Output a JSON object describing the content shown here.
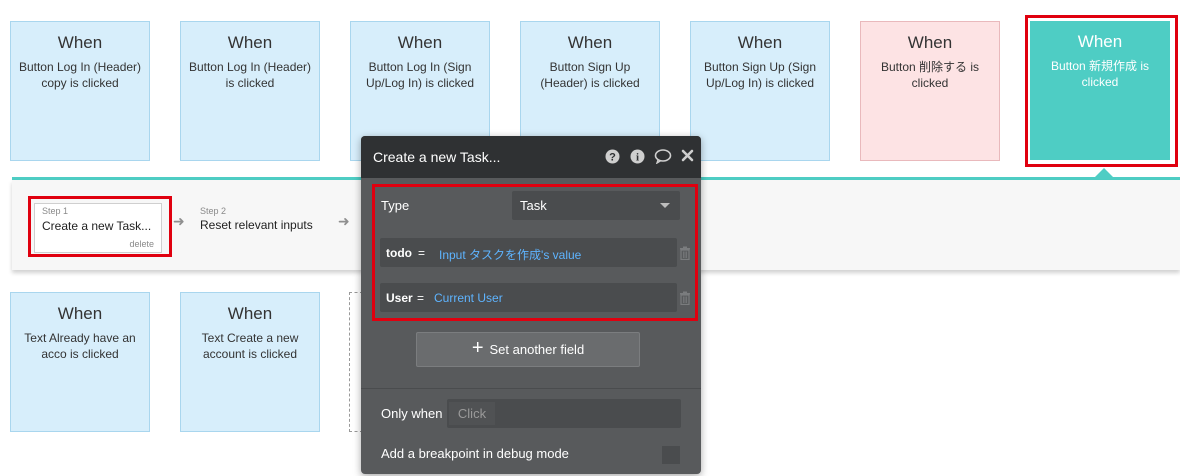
{
  "events": [
    {
      "when": "When",
      "desc": "Button Log In (Header) copy is clicked"
    },
    {
      "when": "When",
      "desc": "Button Log In (Header) is clicked"
    },
    {
      "when": "When",
      "desc": "Button Log In (Sign Up/Log In) is clicked"
    },
    {
      "when": "When",
      "desc": "Button Sign Up (Header) is clicked"
    },
    {
      "when": "When",
      "desc": "Button Sign Up (Sign Up/Log In) is clicked"
    },
    {
      "when": "When",
      "desc": "Button 削除する is clicked"
    },
    {
      "when": "When",
      "desc": "Button 新規作成 is clicked"
    }
  ],
  "events_row2": [
    {
      "when": "When",
      "desc": "Text Already have an acco is clicked"
    },
    {
      "when": "When",
      "desc": "Text Create a new account is clicked"
    }
  ],
  "steps": [
    {
      "num": "Step 1",
      "title": "Create a new Task...",
      "delete": "delete"
    },
    {
      "num": "Step 2",
      "title": "Reset relevant inputs"
    }
  ],
  "popup": {
    "title": "Create a new Task...",
    "type_label": "Type",
    "type_value": "Task",
    "fields": [
      {
        "key": "todo",
        "eq": "=",
        "value": "Input タスクを作成's value"
      },
      {
        "key": "User",
        "eq": "=",
        "value": "Current User"
      }
    ],
    "set_another": "Set another field",
    "only_when_label": "Only when",
    "only_when_placeholder": "Click",
    "breakpoint_label": "Add a breakpoint in debug mode"
  },
  "colors": {
    "accent": "#4ecdc4",
    "highlight": "#e0000f",
    "expression_blue": "#5eb4ff"
  },
  "icons": [
    "help-icon",
    "info-icon",
    "comment-icon",
    "close-icon",
    "plus-icon",
    "trash-icon",
    "arrow-right-icon",
    "dropdown-caret-icon"
  ]
}
